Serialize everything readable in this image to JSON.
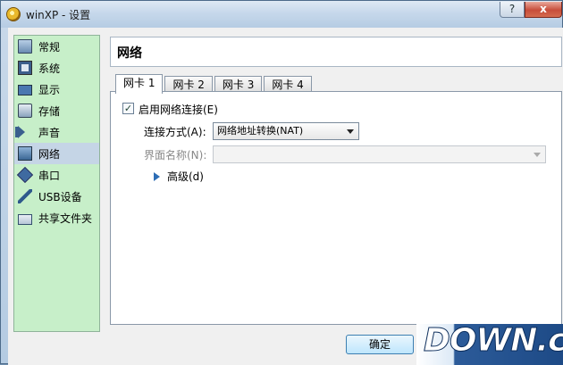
{
  "window": {
    "title": "winXP - 设置",
    "help_label": "?",
    "close_label": "x"
  },
  "sidebar": {
    "items": [
      {
        "label": "常规",
        "icon": "general-icon"
      },
      {
        "label": "系统",
        "icon": "system-icon"
      },
      {
        "label": "显示",
        "icon": "display-icon"
      },
      {
        "label": "存储",
        "icon": "storage-icon"
      },
      {
        "label": "声音",
        "icon": "audio-icon"
      },
      {
        "label": "网络",
        "icon": "network-icon",
        "selected": true
      },
      {
        "label": "串口",
        "icon": "serial-icon"
      },
      {
        "label": "USB设备",
        "icon": "usb-icon"
      },
      {
        "label": "共享文件夹",
        "icon": "shared-folder-icon"
      }
    ]
  },
  "page": {
    "title": "网络"
  },
  "tabs": [
    {
      "label": "网卡 1",
      "active": true
    },
    {
      "label": "网卡 2"
    },
    {
      "label": "网卡 3"
    },
    {
      "label": "网卡 4"
    }
  ],
  "adapter": {
    "enable_label": "启用网络连接(E)",
    "enabled": true,
    "check_mark": "✓",
    "attached_label": "连接方式(A):",
    "attached_value": "网络地址转换(NAT)",
    "name_label": "界面名称(N):",
    "name_value": "",
    "advanced_label": "高级(d)"
  },
  "buttons": {
    "ok_label": "确定"
  },
  "watermark": {
    "text": "DOWN.cc"
  },
  "colors": {
    "sidebar_bg": "#c7efc9",
    "selected_bg": "#c5d5e6",
    "accent": "#2d6db5"
  }
}
